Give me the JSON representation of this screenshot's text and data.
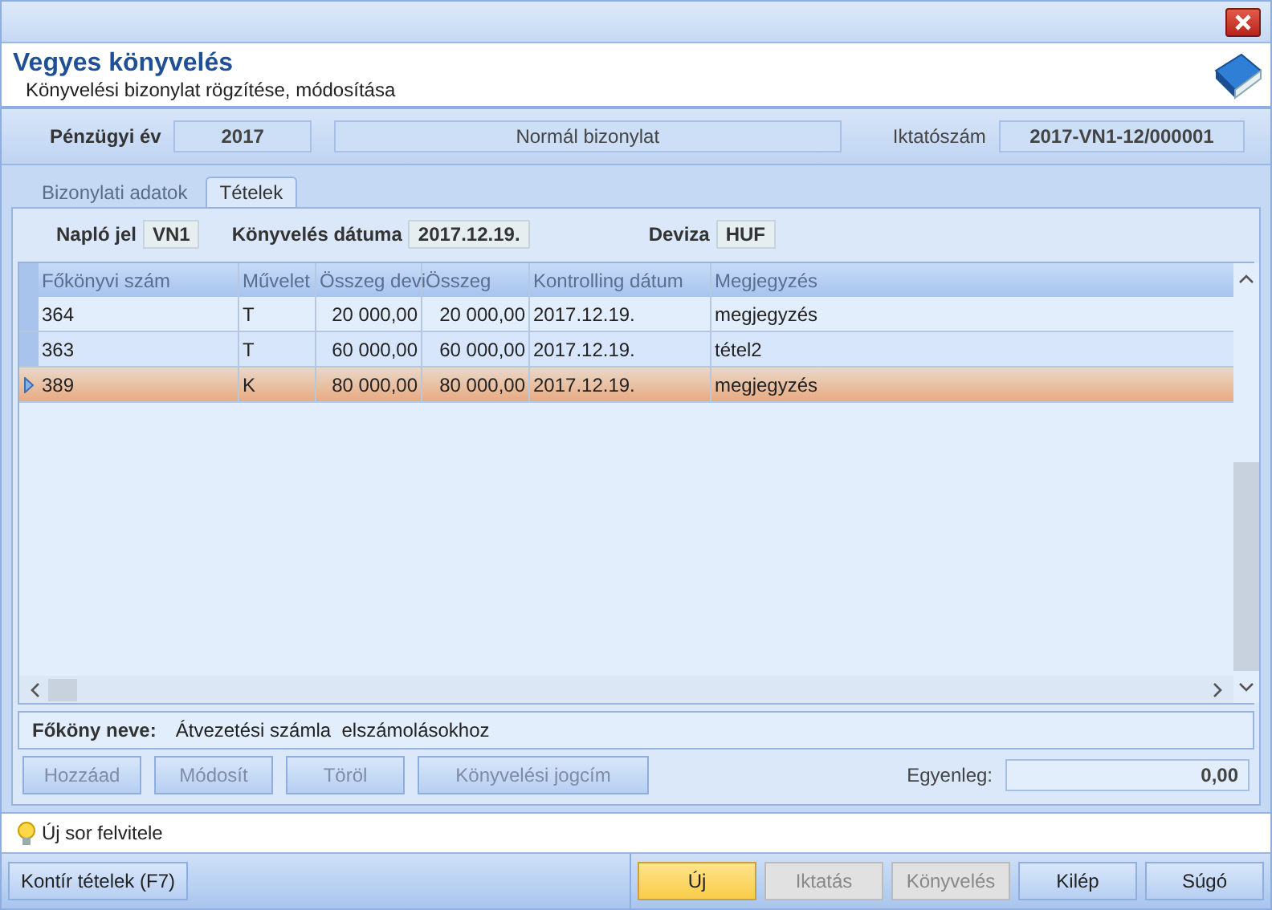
{
  "window": {
    "title": "Vegyes könyvelés",
    "subtitle": "Könyvelési bizonylat rögzítése, módosítása"
  },
  "info": {
    "year_label": "Pénzügyi év",
    "year": "2017",
    "doc_type": "Normál bizonylat",
    "number_label": "Iktatószám",
    "number": "2017-VN1-12/000001"
  },
  "tabs": [
    {
      "label": "Bizonylati adatok",
      "selected": false
    },
    {
      "label": "Tételek",
      "selected": true
    }
  ],
  "fields": [
    {
      "label": "Napló jel",
      "value": "VN1"
    },
    {
      "label": "Könyvelés dátuma",
      "value": "2017.12.19."
    },
    {
      "label": "Deviza",
      "value": "HUF"
    }
  ],
  "table": {
    "columns": [
      "Főkönyvi szám",
      "Művelet",
      "Összeg devi",
      "Összeg",
      "Kontrolling dátum",
      "Megjegyzés"
    ],
    "rows": [
      {
        "cells": [
          "364",
          "T",
          "20 000,00",
          "20 000,00",
          "2017.12.19.",
          "megjegyzés"
        ],
        "selected": false
      },
      {
        "cells": [
          "363",
          "T",
          "60 000,00",
          "60 000,00",
          "2017.12.19.",
          "tétel2"
        ],
        "selected": false
      },
      {
        "cells": [
          "389",
          "K",
          "80 000,00",
          "80 000,00",
          "2017.12.19.",
          "megjegyzés"
        ],
        "selected": true
      }
    ]
  },
  "account": {
    "label": "Főköny neve:",
    "value": "Átvezetési számla  elszámolásokhoz"
  },
  "actions": [
    {
      "label": "Hozzáad",
      "disabled": true
    },
    {
      "label": "Módosít",
      "disabled": true
    },
    {
      "label": "Töröl",
      "disabled": true
    },
    {
      "label": "Könyvelési jogcím",
      "disabled": true
    }
  ],
  "balance": {
    "label": "Egyenleg:",
    "value": "0,00"
  },
  "hint": "Új sor felvitele",
  "footer_left": "Kontír tételek (F7)",
  "footer_buttons": [
    {
      "label": "Új",
      "disabled": false,
      "selected": true
    },
    {
      "label": "Iktatás",
      "disabled": true,
      "selected": false
    },
    {
      "label": "Könyvelés",
      "disabled": true,
      "selected": false
    },
    {
      "label": "Kilép",
      "disabled": false,
      "selected": false
    },
    {
      "label": "Súgó",
      "disabled": false,
      "selected": false
    }
  ]
}
